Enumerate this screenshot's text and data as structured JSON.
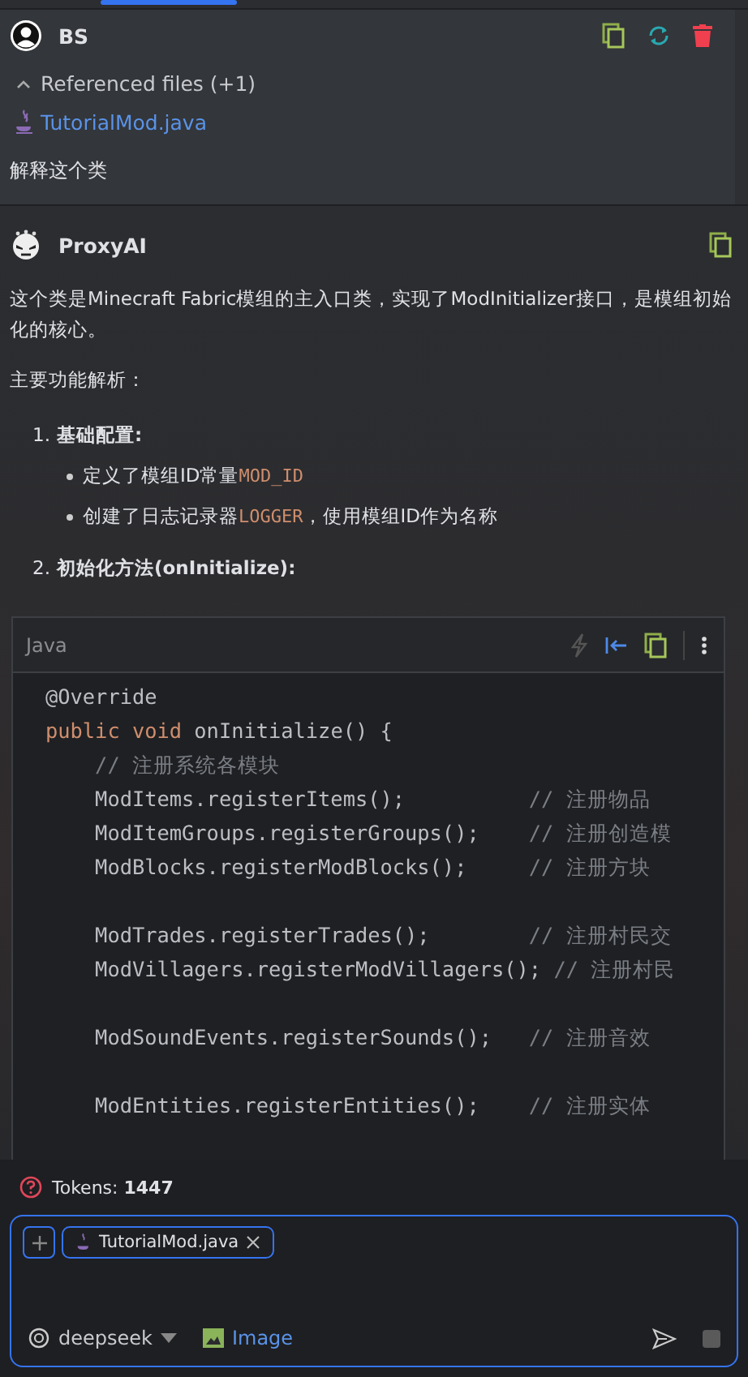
{
  "user_message": {
    "author": "BS",
    "referenced_files": {
      "label": "Referenced files (+1)",
      "expanded": true,
      "files": [
        "TutorialMod.java"
      ]
    },
    "text": "解释这个类"
  },
  "ai_message": {
    "author": "ProxyAI",
    "intro": "这个类是Minecraft Fabric模组的主入口类，实现了ModInitializer接口，是模组初始化的核心。",
    "subtitle": "主要功能解析：",
    "sections": [
      {
        "number": "1.",
        "title": "基础配置:",
        "bullets": [
          {
            "text": "定义了模组ID常量",
            "code": "MOD_ID"
          },
          {
            "text": "创建了日志记录器",
            "code": "LOGGER",
            "after": "，使用模组ID作为名称"
          }
        ]
      },
      {
        "number": "2.",
        "title": "初始化方法(onInitialize):"
      }
    ],
    "code_block": {
      "language": "Java",
      "lines": [
        {
          "blank_before": false,
          "tokens": [
            {
              "kind": "annotation",
              "text": "@Override"
            }
          ]
        },
        {
          "blank_before": false,
          "tokens": [
            {
              "kind": "keyword",
              "text": "public void "
            },
            {
              "kind": "plain",
              "text": "onInitialize() {"
            }
          ]
        },
        {
          "blank_before": false,
          "tokens": [
            {
              "kind": "comment",
              "text": "    // 注册系统各模块"
            }
          ]
        },
        {
          "blank_before": false,
          "tokens": [
            {
              "kind": "plain",
              "text": "    ModItems.registerItems();          "
            },
            {
              "kind": "comment",
              "text": "// 注册物品"
            }
          ]
        },
        {
          "blank_before": false,
          "tokens": [
            {
              "kind": "plain",
              "text": "    ModItemGroups.registerGroups();    "
            },
            {
              "kind": "comment",
              "text": "// 注册创造模"
            }
          ]
        },
        {
          "blank_before": false,
          "tokens": [
            {
              "kind": "plain",
              "text": "    ModBlocks.registerModBlocks();     "
            },
            {
              "kind": "comment",
              "text": "// 注册方块"
            }
          ]
        },
        {
          "blank_before": true,
          "tokens": [
            {
              "kind": "plain",
              "text": "    ModTrades.registerTrades();        "
            },
            {
              "kind": "comment",
              "text": "// 注册村民交"
            }
          ]
        },
        {
          "blank_before": false,
          "tokens": [
            {
              "kind": "plain",
              "text": "    ModVillagers.registerModVillagers(); "
            },
            {
              "kind": "comment",
              "text": "// 注册村民"
            }
          ]
        },
        {
          "blank_before": true,
          "tokens": [
            {
              "kind": "plain",
              "text": "    ModSoundEvents.registerSounds();   "
            },
            {
              "kind": "comment",
              "text": "// 注册音效"
            }
          ]
        },
        {
          "blank_before": true,
          "tokens": [
            {
              "kind": "plain",
              "text": "    ModEntities.registerEntities();    "
            },
            {
              "kind": "comment",
              "text": "// 注册实体"
            }
          ]
        }
      ]
    }
  },
  "tokens": {
    "label": "Tokens:",
    "value": "1447"
  },
  "input": {
    "attachments": [
      "TutorialMod.java"
    ],
    "model": "deepseek",
    "image_label": "Image"
  }
}
